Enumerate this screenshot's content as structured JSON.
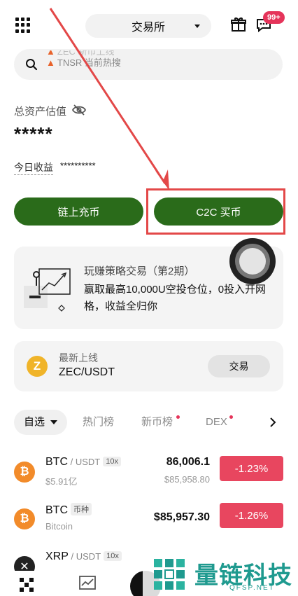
{
  "header": {
    "exchange_label": "交易所",
    "badge": "99+"
  },
  "search": {
    "line1": "ZEC 新币上线",
    "line2": "TNSR 当前热搜"
  },
  "assets": {
    "label": "总资产估值",
    "value": "*****",
    "today_label": "今日收益",
    "today_value": "**********"
  },
  "actions": {
    "deposit_label": "链上充币",
    "c2c_label": "C2C 买币"
  },
  "promo": {
    "title": "玩赚策略交易（第2期）",
    "desc": "赢取最高10,000U空投仓位，0投入开网格，收益全归你"
  },
  "listing": {
    "sub": "最新上线",
    "pair": "ZEC/USDT",
    "trade_label": "交易",
    "icon_letter": "Z"
  },
  "tabs": [
    {
      "label": "自选"
    },
    {
      "label": "热门榜"
    },
    {
      "label": "新币榜"
    },
    {
      "label": "DEX"
    }
  ],
  "rows": [
    {
      "symbol": "BTC",
      "quote": " / USDT",
      "tag": "10x",
      "volume": "$5.91亿",
      "price": "86,006.1",
      "sub_price": "$85,958.80",
      "change": "-1.23%",
      "icon": "₿"
    },
    {
      "symbol": "BTC",
      "quote": "",
      "tag": "币种",
      "volume": "Bitcoin",
      "price": "$85,957.30",
      "sub_price": "",
      "change": "-1.26%",
      "icon": "₿"
    },
    {
      "symbol": "XRP",
      "quote": " / USDT",
      "tag": "10x",
      "volume": "",
      "price": "",
      "sub_price": "",
      "change": "",
      "icon": "✕"
    }
  ],
  "watermark": {
    "text": "量链科技",
    "url": "QFSP.NET"
  },
  "colors": {
    "primary_green": "#2a6b1a",
    "negative_red": "#e8465f",
    "annotation_red": "#e34848"
  }
}
